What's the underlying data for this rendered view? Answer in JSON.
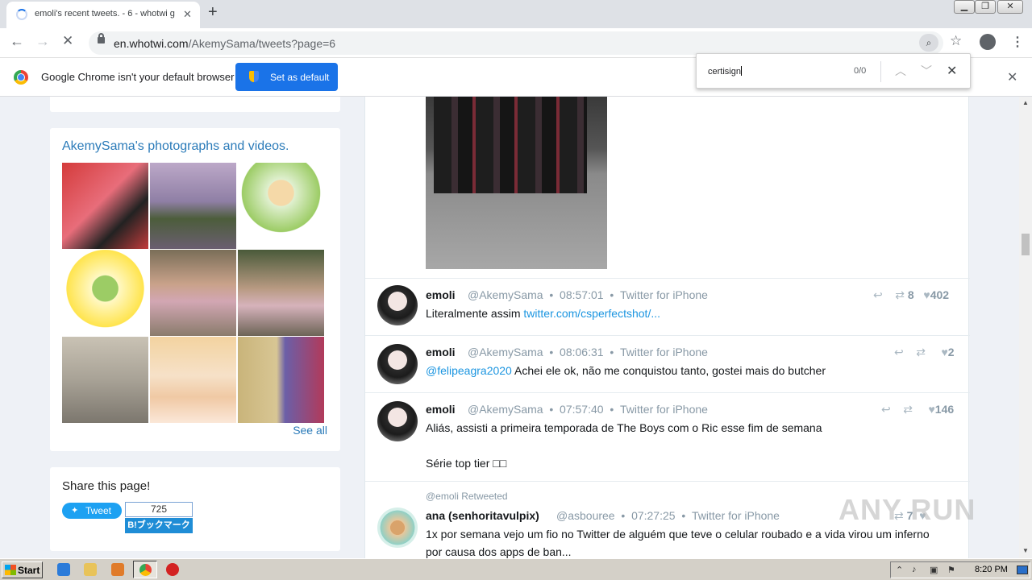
{
  "browser": {
    "tab_title": "emoli's recent tweets. - 6 - whotwi g",
    "tab_close": "✕",
    "new_tab": "+",
    "url_host": "en.whotwi.com",
    "url_path": "/AkemySama/tweets?page=6",
    "window_buttons": [
      "▁",
      "❐",
      "✕"
    ]
  },
  "infobar": {
    "message": "Google Chrome isn't your default browser",
    "button_label": "Set as default",
    "close": "✕"
  },
  "findbar": {
    "query": "certisign",
    "count": "0/0",
    "prev": "︿",
    "next": "﹀",
    "close": "✕"
  },
  "sidebar": {
    "photos_title": "AkemySama's photographs and videos.",
    "see_all": "See all",
    "share_title": "Share this page!",
    "tweet_button": "Tweet",
    "hatena_count": "725",
    "hatena_label": "B!ブックマーク"
  },
  "tweets": [
    {
      "name": "emoli",
      "handle": "@AkemySama",
      "time": "08:57:01",
      "source": "Twitter for iPhone",
      "text": "Literalmente assim ",
      "link": "twitter.com/csperfectshot/...",
      "retweets": "8",
      "likes": "402"
    },
    {
      "name": "emoli",
      "handle": "@AkemySama",
      "time": "08:06:31",
      "source": "Twitter for iPhone",
      "mention": "@felipeagra2020",
      "text": " Achei ele ok, não me conquistou tanto, gostei mais do butcher",
      "retweets": "",
      "likes": "2"
    },
    {
      "name": "emoli",
      "handle": "@AkemySama",
      "time": "07:57:40",
      "source": "Twitter for iPhone",
      "text": "Aliás, assisti a primeira temporada de The Boys com o Ric esse fim de semana",
      "text2": "Série top tier □□",
      "retweets": "",
      "likes": "146"
    },
    {
      "retweeted_by": "@emoli Retweeted",
      "name": "ana (senhoritavulpix)",
      "handle": "@asbouree",
      "time": "07:27:25",
      "source": "Twitter for iPhone",
      "text": "1x por semana vejo um fio no Twitter de alguém que teve o celular roubado e a vida virou um inferno",
      "text2": "por causa dos apps de ban...",
      "retweets": "7",
      "likes": ""
    }
  ],
  "taskbar": {
    "start": "Start",
    "clock": "8:20 PM"
  },
  "watermark": "ANY RUN"
}
